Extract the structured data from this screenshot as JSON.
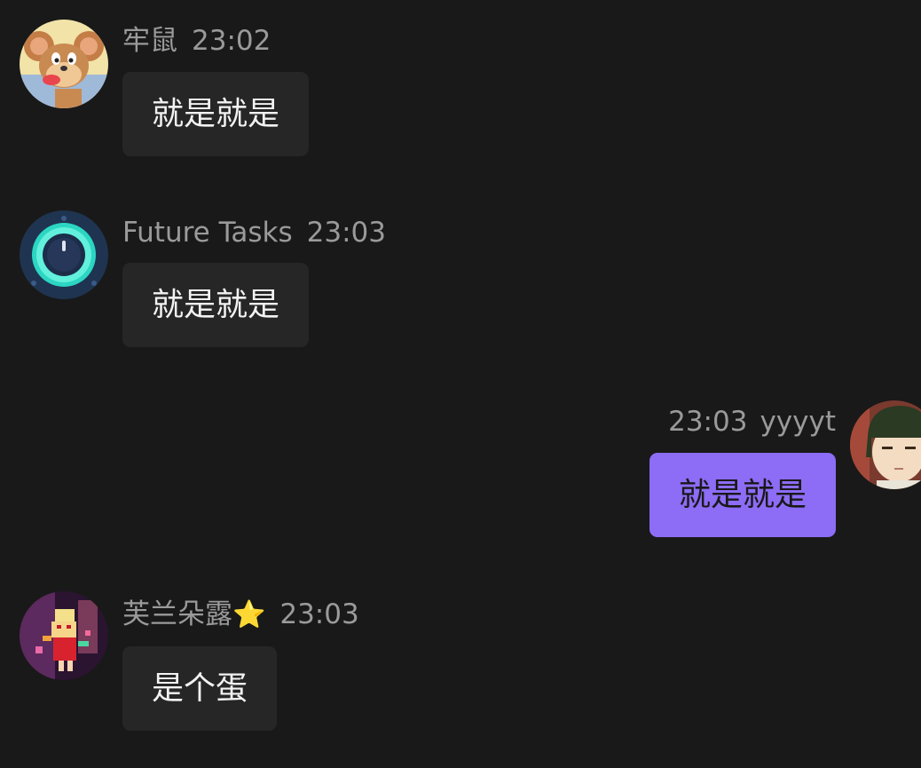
{
  "messages": [
    {
      "sender": "牢鼠",
      "time": "23:02",
      "text": "就是就是",
      "avatar": "jerry-mouse-avatar",
      "outgoing": false
    },
    {
      "sender": "Future Tasks",
      "time": "23:03",
      "text": "就是就是",
      "avatar": "dial-knob-avatar",
      "outgoing": false
    },
    {
      "sender": "yyyyt",
      "time": "23:03",
      "text": "就是就是",
      "avatar": "anime-boy-avatar",
      "outgoing": true
    },
    {
      "sender": "芙兰朵露",
      "sender_emoji": "⭐",
      "time": "23:03",
      "text": "是个蛋",
      "avatar": "pixel-vampire-girl-avatar",
      "outgoing": false
    }
  ],
  "colors": {
    "background": "#191919",
    "incoming_bubble": "#262626",
    "outgoing_bubble": "#8d6cf6",
    "meta_text": "#9a9a9a"
  }
}
